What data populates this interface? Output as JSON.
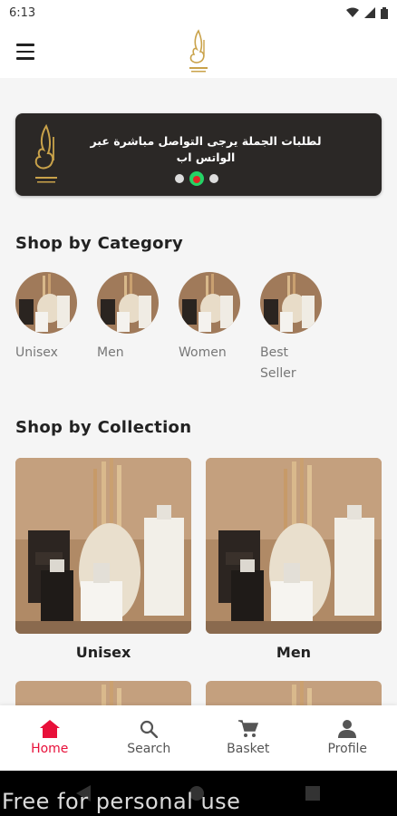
{
  "status_bar": {
    "time": "6:13",
    "icons": [
      "wifi-icon",
      "signal-icon",
      "battery-icon"
    ]
  },
  "app_bar": {
    "menu_icon": "hamburger-menu-icon",
    "logo": "brand-logo"
  },
  "banner": {
    "text": "لطلبات الجملة يرجى التواصل مباشرة عبر الواتس اب",
    "indicators": 3,
    "active_indicator": 2
  },
  "sections": {
    "category_title": "Shop by Category",
    "collection_title": "Shop by Collection"
  },
  "categories": [
    {
      "label": "Unisex"
    },
    {
      "label": "Men"
    },
    {
      "label": "Women"
    },
    {
      "label": "Best Seller"
    }
  ],
  "collections": [
    {
      "label": "Unisex"
    },
    {
      "label": "Men"
    },
    {
      "label": ""
    },
    {
      "label": ""
    }
  ],
  "bottom_nav": [
    {
      "label": "Home",
      "icon": "home-icon",
      "active": true
    },
    {
      "label": "Search",
      "icon": "search-icon",
      "active": false
    },
    {
      "label": "Basket",
      "icon": "cart-icon",
      "active": false
    },
    {
      "label": "Profile",
      "icon": "person-icon",
      "active": false
    }
  ],
  "watermark": "Free for personal use",
  "colors": {
    "accent": "#e8103a",
    "banner_bg": "#2b2826",
    "whatsapp": "#25d366"
  }
}
